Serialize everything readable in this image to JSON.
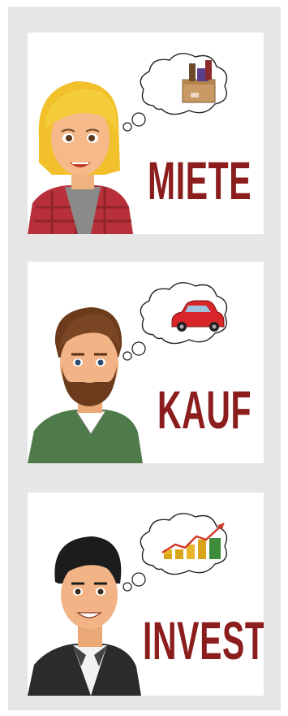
{
  "panels": [
    {
      "id": "miete",
      "label": "MIETE",
      "thought": "moving-box-icon"
    },
    {
      "id": "kauf",
      "label": "KAUF",
      "thought": "red-car-icon"
    },
    {
      "id": "invest",
      "label": "INVEST",
      "thought": "money-growth-icon"
    }
  ],
  "colors": {
    "label": "#8c1d1d",
    "frame": "#e6e6e6",
    "panel": "#ffffff"
  }
}
